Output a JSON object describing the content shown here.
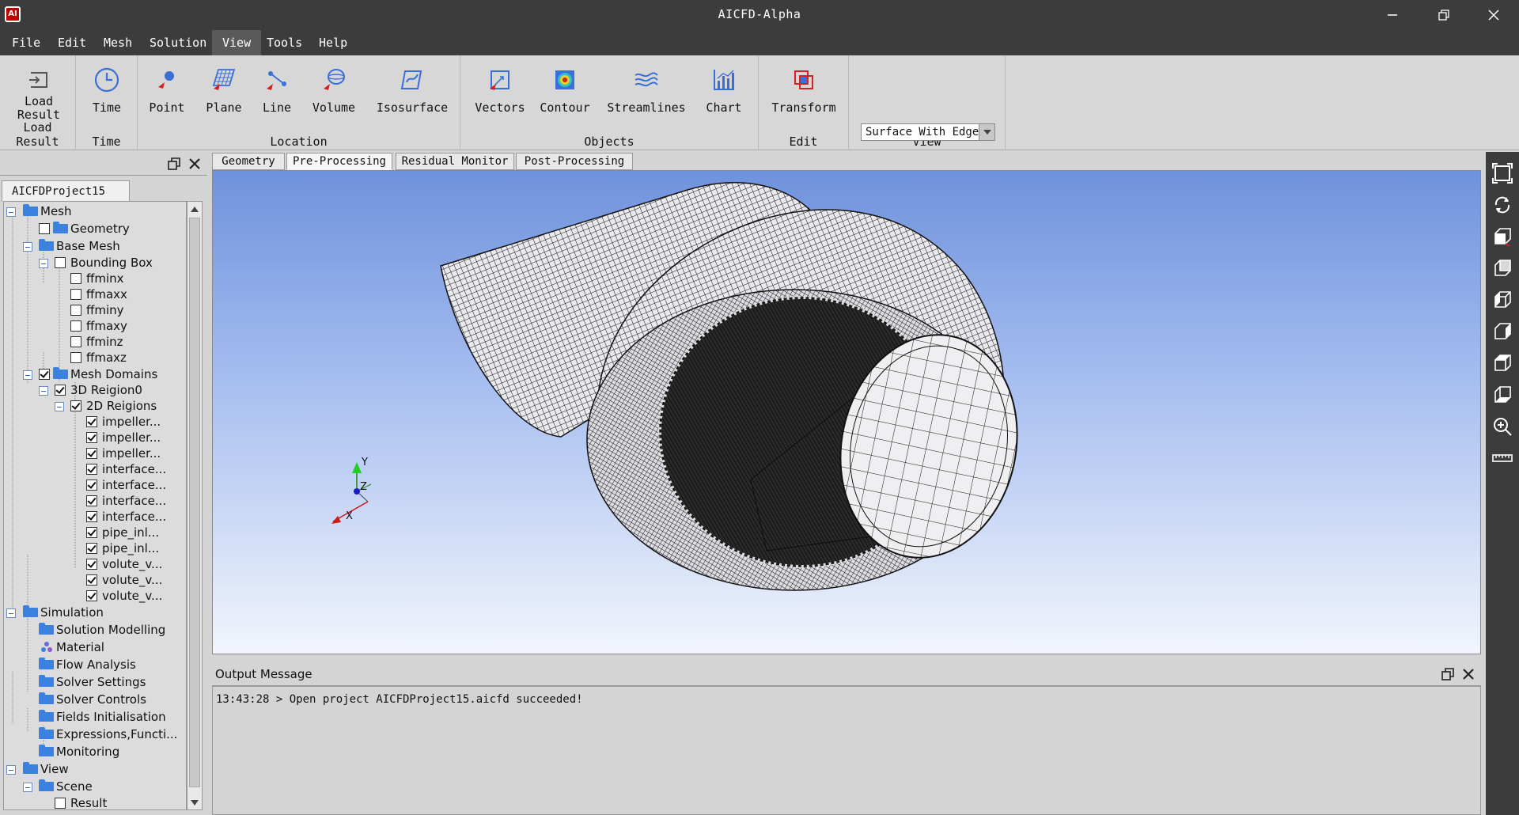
{
  "app": {
    "title": "AICFD-Alpha",
    "logo_text": "AI",
    "window_controls": [
      "minimize",
      "restore",
      "close"
    ]
  },
  "menu": [
    "File",
    "Edit",
    "Mesh",
    "Solution",
    "View",
    "Tools",
    "Help"
  ],
  "menu_active": "View",
  "ribbon": {
    "groups": [
      {
        "label": "Load Result",
        "buttons": [
          {
            "label_line1": "Load",
            "label_line2": "Result",
            "icon": "load-result-icon"
          }
        ]
      },
      {
        "label": "Time",
        "buttons": [
          {
            "label_line1": "Time",
            "icon": "clock-icon"
          }
        ]
      },
      {
        "label": "Location",
        "buttons": [
          {
            "label_line1": "Point",
            "icon": "point-icon"
          },
          {
            "label_line1": "Plane",
            "icon": "plane-icon"
          },
          {
            "label_line1": "Line",
            "icon": "line-icon"
          },
          {
            "label_line1": "Volume",
            "icon": "volume-icon"
          },
          {
            "label_line1": "Isosurface",
            "icon": "isosurface-icon"
          }
        ]
      },
      {
        "label": "Objects",
        "buttons": [
          {
            "label_line1": "Vectors",
            "icon": "vectors-icon"
          },
          {
            "label_line1": "Contour",
            "icon": "contour-icon"
          },
          {
            "label_line1": "Streamlines",
            "icon": "streamlines-icon"
          },
          {
            "label_line1": "Chart",
            "icon": "chart-icon"
          }
        ]
      },
      {
        "label": "Edit",
        "buttons": [
          {
            "label_line1": "Transform",
            "icon": "transform-icon"
          }
        ]
      },
      {
        "label": "View",
        "buttons": []
      }
    ],
    "view_select": {
      "value": "Surface With Edge"
    }
  },
  "left_panel": {
    "project_tab": "AICFDProject15",
    "tree": [
      {
        "label": "Mesh"
      },
      {
        "label": "Geometry"
      },
      {
        "label": "Base Mesh"
      },
      {
        "label": "Bounding Box"
      },
      {
        "label": "ffminx"
      },
      {
        "label": "ffmaxx"
      },
      {
        "label": "ffminy"
      },
      {
        "label": "ffmaxy"
      },
      {
        "label": "ffminz"
      },
      {
        "label": "ffmaxz"
      },
      {
        "label": "Mesh Domains"
      },
      {
        "label": "3D Reigion0"
      },
      {
        "label": "2D Reigions"
      },
      {
        "label": "impeller..."
      },
      {
        "label": "impeller..."
      },
      {
        "label": "impeller..."
      },
      {
        "label": "interface..."
      },
      {
        "label": "interface..."
      },
      {
        "label": "interface..."
      },
      {
        "label": "interface..."
      },
      {
        "label": "pipe_inl..."
      },
      {
        "label": "pipe_inl..."
      },
      {
        "label": "volute_v..."
      },
      {
        "label": "volute_v..."
      },
      {
        "label": "volute_v..."
      },
      {
        "label": "Simulation"
      },
      {
        "label": "Solution Modelling"
      },
      {
        "label": "Material"
      },
      {
        "label": "Flow Analysis"
      },
      {
        "label": "Solver Settings"
      },
      {
        "label": "Solver Controls"
      },
      {
        "label": "Fields Initialisation"
      },
      {
        "label": "Expressions,Functi..."
      },
      {
        "label": "Monitoring"
      },
      {
        "label": "View"
      },
      {
        "label": "Scene"
      },
      {
        "label": "Result"
      }
    ]
  },
  "tabs": [
    "Geometry",
    "Pre-Processing",
    "Residual Monitor",
    "Post-Processing"
  ],
  "active_tab": "Pre-Processing",
  "viewport": {
    "axes": {
      "y": "Y",
      "z": "Z",
      "x": "X"
    },
    "render_mode": "Surface With Edge"
  },
  "right_toolbar": [
    "fit-view-icon",
    "rotate-icon",
    "view-front-icon",
    "view-back-icon",
    "view-left-icon",
    "view-right-icon",
    "view-top-icon",
    "view-bottom-icon",
    "zoom-icon",
    "ruler-icon"
  ],
  "output": {
    "title": "Output Message",
    "message": "13:43:28 > Open project AICFDProject15.aicfd succeeded!"
  },
  "colors": {
    "accent": "#3b6fd8",
    "titlebar": "#3c3c3c",
    "red_marker": "#d52020"
  }
}
